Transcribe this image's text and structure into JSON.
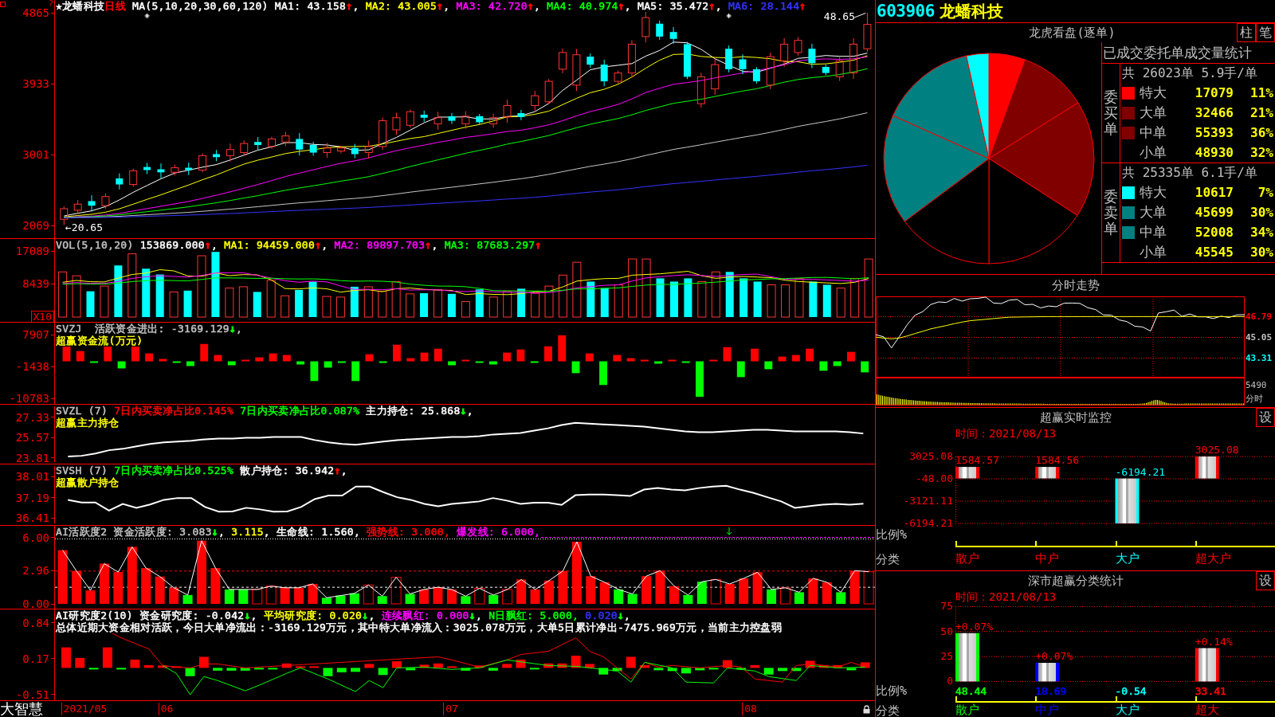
{
  "main": {
    "panels": [
      {
        "kind": "price",
        "axis_ticks": [
          "4865",
          "3933",
          "3001",
          "2069"
        ],
        "marker": "?",
        "legend_lines": [
          {
            "color": "#ffffff",
            "runs": [
              {
                "text": "★龙蟠科技"
              },
              {
                "text": "日线",
                "color": "#ff0000"
              },
              {
                "text": " MA(5,10,20,30,60,120) MA1: 43.158",
                "arrow": {
                  "text": "↑",
                  "color": "#ff0000"
                }
              },
              {
                "text": ", "
              },
              {
                "text": "MA2: 43.005",
                "color": "#ffff00",
                "arrow": {
                  "text": "↑",
                  "color": "#ff0000"
                }
              },
              {
                "text": ", "
              },
              {
                "text": "MA3: 42.720",
                "color": "#ff00ff",
                "arrow": {
                  "text": "↑",
                  "color": "#ff0000"
                }
              },
              {
                "text": ", "
              },
              {
                "text": "MA4: 40.974",
                "color": "#00ff00",
                "arrow": {
                  "text": "↑",
                  "color": "#ff0000"
                }
              },
              {
                "text": ", MA5: 35.472",
                "arrow": {
                  "text": "↑",
                  "color": "#ff0000"
                }
              },
              {
                "text": ", "
              },
              {
                "text": "MA6: 28.144",
                "color": "#3333ff",
                "arrow": {
                  "text": "↑",
                  "color": "#ff0000"
                }
              }
            ]
          }
        ],
        "high_label": "48.65",
        "low_label": "←20.65"
      },
      {
        "kind": "volume",
        "axis_ticks": [
          "17089",
          "8439"
        ],
        "unit": "X10",
        "legend_lines": [
          {
            "color": "#ffffff",
            "runs": [
              {
                "text": "VOL(5,10,20) ",
                "color": "#c0c0c0"
              },
              {
                "text": "153869.000",
                "arrow": {
                  "text": "↑",
                  "color": "#ff0000"
                }
              },
              {
                "text": ", "
              },
              {
                "text": "MA1: 94459.000",
                "color": "#ffff00",
                "arrow": {
                  "text": "↑",
                  "color": "#ff0000"
                }
              },
              {
                "text": ", "
              },
              {
                "text": "MA2: 89897.703",
                "color": "#ff00ff",
                "arrow": {
                  "text": "↑",
                  "color": "#ff0000"
                }
              },
              {
                "text": ", "
              },
              {
                "text": "MA3: 87683.297",
                "color": "#00ff00",
                "arrow": {
                  "text": "↑",
                  "color": "#ff0000"
                }
              }
            ]
          }
        ]
      },
      {
        "kind": "flow",
        "axis_ticks": [
          "7907",
          "-1438",
          "-10783"
        ],
        "legend_lines": [
          {
            "color": "#c0c0c0",
            "runs": [
              {
                "text": "SVZJ  活跃资金进出: -3169.129",
                "arrow": {
                  "text": "↓",
                  "color": "#00ff00"
                }
              },
              {
                "text": ","
              }
            ]
          },
          {
            "color": "#ffff00",
            "runs": [
              {
                "text": "超赢资金流(万元)"
              }
            ]
          }
        ]
      },
      {
        "kind": "holding_main",
        "legend_lines": [
          {
            "color": "#ffffff",
            "runs": [
              {
                "text": "SVZL (7) ",
                "color": "#c0c0c0"
              },
              {
                "text": "7日内买卖净占比0.145%",
                "color": "#ff0000"
              },
              {
                "text": " 7日内买卖净占比0.087%",
                "color": "#00ff00"
              },
              {
                "text": " 主力持仓: 25.868",
                "arrow": {
                  "text": "↓",
                  "color": "#00ff00"
                }
              },
              {
                "text": ","
              }
            ]
          },
          {
            "color": "#ffff00",
            "runs": [
              {
                "text": "超赢主力持仓"
              }
            ]
          }
        ],
        "chart_data": {
          "type": "line",
          "ylim": [
            23.43,
            28.26
          ],
          "yticks": [
            27.33,
            25.57,
            23.81
          ],
          "series": [
            {
              "color": "#ffffff",
              "values": [
                23.85,
                23.91,
                24.12,
                24.4,
                24.53,
                24.74,
                24.95,
                25.09,
                25.16,
                25.23,
                25.36,
                25.43,
                25.43,
                25.5,
                25.5,
                25.57,
                25.57,
                25.57,
                25.29,
                25.09,
                24.95,
                24.88,
                25.02,
                25.16,
                25.29,
                25.36,
                25.43,
                25.5,
                25.57,
                25.57,
                25.64,
                25.78,
                25.85,
                25.92,
                26.12,
                26.33,
                26.61,
                26.81,
                26.74,
                26.67,
                26.61,
                26.54,
                26.47,
                26.33,
                26.19,
                26.05,
                25.98,
                25.98,
                26.05,
                26.12,
                26.19,
                26.19,
                26.12,
                26.05,
                26.05,
                26.05,
                26.05,
                25.98,
                25.87
              ]
            }
          ]
        }
      },
      {
        "kind": "holding_retail",
        "legend_lines": [
          {
            "color": "#ffffff",
            "runs": [
              {
                "text": "SVSH (7) ",
                "color": "#c0c0c0"
              },
              {
                "text": "7日内买卖净占比0.525%",
                "color": "#00ff00"
              },
              {
                "text": " 散户持仓: 36.942",
                "arrow": {
                  "text": "↑",
                  "color": "#ff0000"
                }
              },
              {
                "text": ","
              }
            ]
          },
          {
            "color": "#ffff00",
            "runs": [
              {
                "text": "超赢散户持仓"
              }
            ]
          }
        ],
        "chart_data": {
          "type": "line",
          "ylim": [
            36.2,
            38.41
          ],
          "yticks": [
            38.01,
            37.19,
            36.41
          ],
          "series": [
            {
              "color": "#ffffff",
              "values": [
                37.09,
                36.99,
                36.99,
                36.67,
                36.93,
                36.78,
                36.91,
                37.09,
                37.16,
                37.16,
                36.81,
                36.63,
                36.64,
                36.78,
                36.72,
                36.63,
                36.64,
                36.81,
                37.12,
                37.26,
                37.26,
                37.61,
                37.61,
                37.39,
                37.19,
                37.09,
                36.93,
                36.84,
                36.93,
                36.98,
                37.03,
                37.16,
                37.06,
                36.93,
                36.98,
                36.98,
                36.89,
                37.27,
                37.3,
                37.3,
                37.27,
                37.24,
                37.49,
                37.55,
                37.49,
                37.46,
                37.55,
                37.61,
                37.64,
                37.49,
                37.36,
                37.19,
                37.03,
                36.78,
                36.84,
                36.9,
                36.93,
                36.9,
                36.94
              ]
            }
          ]
        }
      },
      {
        "kind": "activity",
        "axis_ticks": [
          "6.00",
          "2.96",
          "0.00"
        ],
        "legend_lines": [
          {
            "color": "#ffffff",
            "runs": [
              {
                "text": "AI活跃度2 资金活跃度: 3.083",
                "color": "#c0c0c0",
                "arrow": {
                  "text": "↓",
                  "color": "#00ff00"
                }
              },
              {
                "text": ", "
              },
              {
                "text": "3.115",
                "color": "#ffff00"
              },
              {
                "text": ", 生命线: 1.560, "
              },
              {
                "text": "强势线: 3.000,",
                "color": "#ff0000"
              },
              {
                "text": " 爆发线: 6.000,",
                "color": "#ff00ff"
              }
            ]
          }
        ]
      },
      {
        "kind": "research",
        "axis_ticks": [
          "0.84",
          "0.17",
          "-0.51"
        ],
        "legend_lines": [
          {
            "color": "#ffffff",
            "runs": [
              {
                "text": "AI研究度2(10) 资金研究度: -0.042",
                "arrow": {
                  "text": "↓",
                  "color": "#00ff00"
                }
              },
              {
                "text": ", "
              },
              {
                "text": "平均研究度: 0.020",
                "color": "#ffff00",
                "arrow": {
                  "text": "↓",
                  "color": "#00ff00"
                }
              },
              {
                "text": ", "
              },
              {
                "text": "连续飘红: 0.000",
                "color": "#ff00ff",
                "arrow": {
                  "text": "↓",
                  "color": "#00ff00"
                }
              },
              {
                "text": ", "
              },
              {
                "text": "N日飘红: 5.000,",
                "color": "#00ff00"
              },
              {
                "text": " 0.020",
                "color": "#3333ff",
                "arrow": {
                  "text": "↓",
                  "color": "#00ff00"
                }
              },
              {
                "text": ","
              }
            ]
          },
          {
            "color": "#ffffff",
            "runs": [
              {
                "text": "总体近期大资金相对活跃，今日大单净流出：-3169.129万元，其中特大单净流入：3025.078万元，大单5日累计净出-7475.969万元，当前主力控盘弱"
              }
            ]
          }
        ]
      }
    ],
    "date_axis": {
      "brand": "大智慧",
      "dates": [
        "2021/05",
        "06",
        "07",
        "08"
      ]
    }
  },
  "quote": {
    "code": "603906",
    "name": "龙蟠科技"
  },
  "order_panel": {
    "title": "龙虎看盘(逐单)",
    "buttons": [
      "柱",
      "笔"
    ],
    "table_title": "已成交委托单成交量统计",
    "groups": [
      {
        "side": "委买单",
        "summary": "共 26023单 5.9手/单",
        "rows": [
          {
            "label": "特大",
            "volume": "17079",
            "share": "11%",
            "color": "#ff0000"
          },
          {
            "label": "大单",
            "volume": "32466",
            "share": "21%",
            "color": "#800000"
          },
          {
            "label": "中单",
            "volume": "55393",
            "share": "36%",
            "color": "#800000"
          },
          {
            "label": "小单",
            "volume": "48930",
            "share": "32%"
          }
        ]
      },
      {
        "side": "委卖单",
        "summary": "共 25335单 6.1手/单",
        "rows": [
          {
            "label": "特大",
            "volume": "10617",
            "share": "7%",
            "color": "#00ffff"
          },
          {
            "label": "大单",
            "volume": "45699",
            "share": "30%",
            "color": "#008080"
          },
          {
            "label": "中单",
            "volume": "52008",
            "share": "34%",
            "color": "#008080"
          },
          {
            "label": "小单",
            "volume": "45545",
            "share": "30%"
          }
        ]
      }
    ]
  },
  "intraday": {
    "title": "分时走势",
    "tick_styles": [
      {
        "color": "#ff0000"
      },
      {
        "color": "#c0c0c0"
      },
      {
        "color": "#00ffff"
      }
    ],
    "chart_data": {
      "type": "line",
      "grid": true,
      "ylim": [
        41.67,
        48.5
      ],
      "yticks": [
        46.79,
        45.05,
        43.31
      ],
      "series": [
        {
          "color": "#ffffff",
          "values": [
            45.28,
            45.1,
            44.17,
            45.12,
            46.11,
            46.92,
            47.22,
            47.82,
            48.03,
            47.99,
            48.32,
            48.1,
            48.3,
            48.33,
            48.44,
            47.94,
            47.9,
            48.18,
            48.24,
            47.8,
            47.83,
            47.53,
            47.69,
            47.63,
            47.93,
            47.94,
            47.91,
            47.55,
            47.39,
            46.94,
            46.92,
            46.52,
            46.38,
            45.99,
            45.93,
            45.59,
            47.1,
            47.21,
            47.35,
            46.82,
            47.02,
            46.78,
            46.78,
            46.64,
            46.83,
            46.72,
            46.94,
            46.96
          ]
        },
        {
          "color": "#ffff00",
          "values": [
            45.08,
            44.99,
            44.93,
            45.0,
            45.17,
            45.37,
            45.57,
            45.77,
            45.91,
            46.05,
            46.2,
            46.34,
            46.45,
            46.51,
            46.57,
            46.63,
            46.69,
            46.75,
            46.76,
            46.77,
            46.78,
            46.79,
            46.8,
            46.8,
            46.8,
            46.8,
            46.8,
            46.8,
            46.8,
            46.8,
            46.8,
            46.8,
            46.8,
            46.8,
            46.8,
            46.8,
            46.8,
            46.8,
            46.8,
            46.8,
            46.8,
            46.8,
            46.8,
            46.8,
            46.8,
            46.8,
            46.8,
            46.8
          ]
        }
      ]
    },
    "volume_label": "5490",
    "unit_label": "分时"
  },
  "realtime_monitor": {
    "title": "超赢实时监控",
    "button": "设",
    "time": "时间：2021/08/13",
    "ratio_label": "比例%",
    "category_label": "分类",
    "chart_data": {
      "type": "bar",
      "grid": true,
      "categories": [
        "散户",
        "中户",
        "大户",
        "超大户"
      ],
      "values": [
        1584.57,
        1584.56,
        -6194.21,
        3025.08
      ],
      "ylim": [
        -6194.21,
        3025.08
      ],
      "yticks": [
        3025.08,
        {
          "value": -48,
          "label": "-48.00"
        },
        -3121.11,
        -6194.21
      ],
      "data_labels": true
    }
  },
  "sector_stats": {
    "title": "深市超赢分类统计",
    "button": "设",
    "time": "时间：2021/08/13",
    "ratio_label": "比例%",
    "category_label": "分类",
    "bars": [
      {
        "color": "#00ff00",
        "change": "+0.07%"
      },
      {
        "color": "#0000ff",
        "change": "+0.07%"
      },
      {
        "color": "#00ffff"
      },
      {
        "color": "#ff0000",
        "change": "+0.14%"
      }
    ],
    "chart_data": {
      "type": "bar",
      "grid": true,
      "categories": [
        "散户",
        "中户",
        "大户",
        "超大"
      ],
      "values": [
        48.44,
        18.69,
        null,
        33.41
      ],
      "value_labels": [
        "48.44",
        "18.69",
        "-0.54",
        "33.41"
      ],
      "ylim": [
        0,
        75
      ],
      "yticks": [
        75,
        50,
        25,
        0
      ]
    }
  }
}
